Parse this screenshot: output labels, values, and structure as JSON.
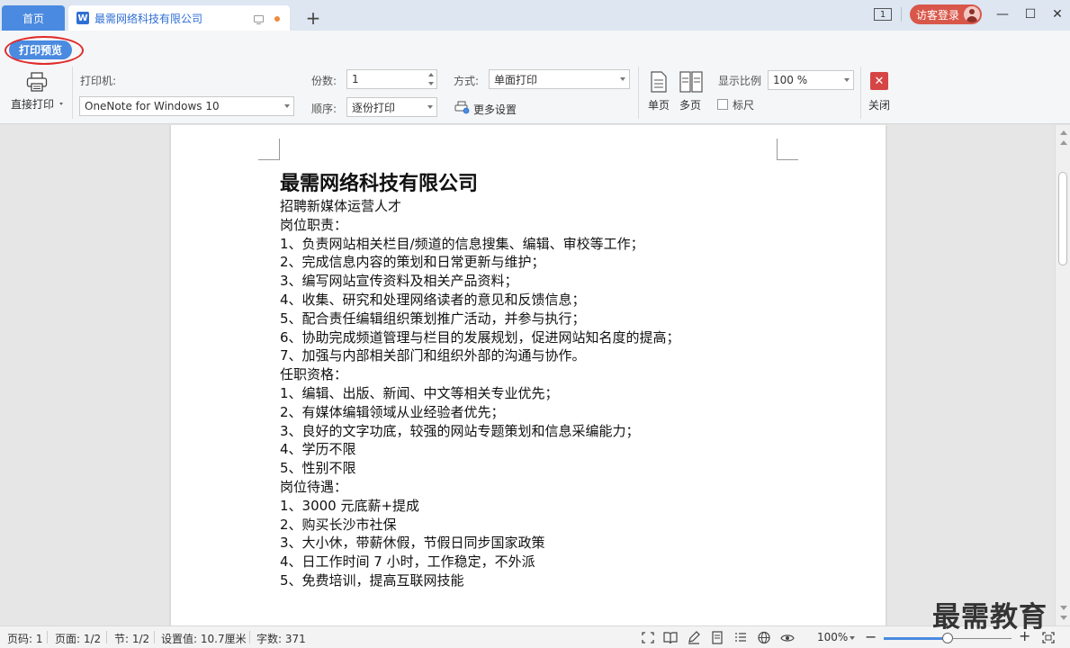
{
  "title_bar": {
    "home_tab": "首页",
    "doc_tab": "最需网络科技有限公司",
    "new_tab": "+",
    "window_badge": "1",
    "visitor_login": "访客登录",
    "minimize": "—",
    "maximize": "☐",
    "close": "✕"
  },
  "toolbar": {
    "print_preview_tab": "打印预览",
    "direct_print": "直接打印",
    "printer_label": "打印机:",
    "printer_value": "OneNote for Windows 10",
    "copies_label": "份数:",
    "copies_value": "1",
    "order_label": "顺序:",
    "order_value": "逐份打印",
    "mode_label": "方式:",
    "mode_value": "单面打印",
    "more_settings": "更多设置",
    "single_page": "单页",
    "multi_page": "多页",
    "zoom_label": "显示比例",
    "zoom_value": "100 %",
    "ruler_label": "标尺",
    "close_label": "关闭"
  },
  "document": {
    "title": "最需网络科技有限公司",
    "lines": [
      "招聘新媒体运营人才",
      "岗位职责：",
      "1、负责网站相关栏目/频道的信息搜集、编辑、审校等工作；",
      "2、完成信息内容的策划和日常更新与维护；",
      "3、编写网站宣传资料及相关产品资料；",
      "4、收集、研究和处理网络读者的意见和反馈信息；",
      "5、配合责任编辑组织策划推广活动，并参与执行；",
      "6、协助完成频道管理与栏目的发展规划，促进网站知名度的提高；",
      "7、加强与内部相关部门和组织外部的沟通与协作。",
      "任职资格：",
      "1、编辑、出版、新闻、中文等相关专业优先；",
      "2、有媒体编辑领域从业经验者优先；",
      "3、良好的文字功底，较强的网站专题策划和信息采编能力；",
      "4、学历不限",
      "5、性别不限",
      "岗位待遇：",
      "1、3000 元底薪+提成",
      "2、购买长沙市社保",
      "3、大小休，带薪休假，节假日同步国家政策",
      "4、日工作时间 7 小时，工作稳定，不外派",
      "5、免费培训，提高互联网技能"
    ]
  },
  "status_bar": {
    "page_code": "页码: 1",
    "page": "页面: 1/2",
    "section": "节: 1/2",
    "setting": "设置值: 10.7厘米",
    "word_count": "字数: 371",
    "zoom_percent": "100%",
    "zoom_level": 0.5
  },
  "watermark": "最需教育",
  "colors": {
    "accent": "#4a8ae0",
    "highlight_ring": "#e02a2a",
    "close_red": "#d64545",
    "visitor_red": "#d8574a"
  }
}
